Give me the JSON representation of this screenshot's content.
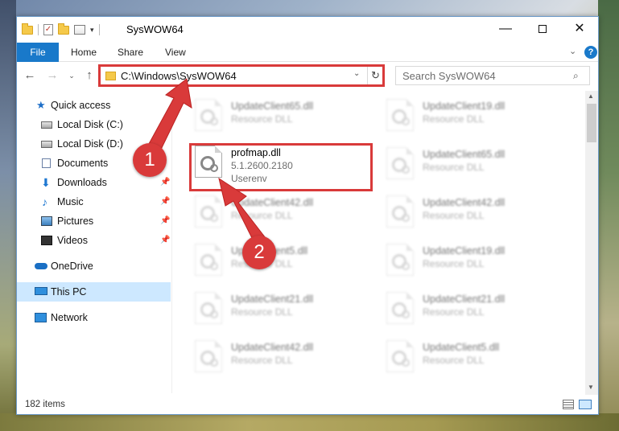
{
  "window": {
    "title": "SysWOW64",
    "minimize": "—",
    "close": "✕"
  },
  "ribbon": {
    "tabs": [
      "File",
      "Home",
      "Share",
      "View"
    ],
    "help": "?",
    "expand": "⌄"
  },
  "navigation": {
    "back": "←",
    "forward": "→",
    "recent": "⌄",
    "up": "↑",
    "address": "C:\\Windows\\SysWOW64",
    "address_dropdown": "⌄",
    "refresh": "↻",
    "search_placeholder": "Search SysWOW64"
  },
  "sidebar": {
    "items": [
      {
        "label": "Quick access",
        "icon": "star-icon",
        "pinned": false
      },
      {
        "label": "Local Disk (C:)",
        "icon": "drive-icon",
        "pinned": false
      },
      {
        "label": "Local Disk (D:)",
        "icon": "drive-icon",
        "pinned": false
      },
      {
        "label": "Documents",
        "icon": "documents-icon",
        "pinned": false
      },
      {
        "label": "Downloads",
        "icon": "download-icon",
        "pinned": true
      },
      {
        "label": "Music",
        "icon": "music-icon",
        "pinned": true
      },
      {
        "label": "Pictures",
        "icon": "pictures-icon",
        "pinned": true
      },
      {
        "label": "Videos",
        "icon": "videos-icon",
        "pinned": true
      },
      {
        "label": "OneDrive",
        "icon": "onedrive-icon",
        "pinned": false
      },
      {
        "label": "This PC",
        "icon": "this-pc-icon",
        "pinned": false,
        "selected": true
      },
      {
        "label": "Network",
        "icon": "network-icon",
        "pinned": false
      }
    ],
    "pin_glyph": "📌"
  },
  "files": {
    "left_column": [
      {
        "name": "UpdateClient65.dll",
        "desc": "Resource DLL"
      },
      {
        "name": "profmap.dll",
        "desc": "5.1.2600.2180",
        "desc2": "Userenv",
        "focused": true
      },
      {
        "name": "UpdateClient42.dll",
        "desc": "Resource DLL"
      },
      {
        "name": "UpdateClient5.dll",
        "desc": "Resource DLL"
      },
      {
        "name": "UpdateClient21.dll",
        "desc": "Resource DLL"
      },
      {
        "name": "UpdateClient42.dll",
        "desc": "Resource DLL"
      }
    ],
    "right_column": [
      {
        "name": "UpdateClient19.dll",
        "desc": "Resource DLL"
      },
      {
        "name": "UpdateClient65.dll",
        "desc": "Resource DLL"
      },
      {
        "name": "UpdateClient42.dll",
        "desc": "Resource DLL"
      },
      {
        "name": "UpdateClient19.dll",
        "desc": "Resource DLL"
      },
      {
        "name": "UpdateClient21.dll",
        "desc": "Resource DLL"
      },
      {
        "name": "UpdateClient5.dll",
        "desc": "Resource DLL"
      }
    ]
  },
  "status": {
    "item_count": "182 items"
  },
  "annotations": {
    "step1": "1",
    "step2": "2",
    "accent": "#d93a3a"
  }
}
